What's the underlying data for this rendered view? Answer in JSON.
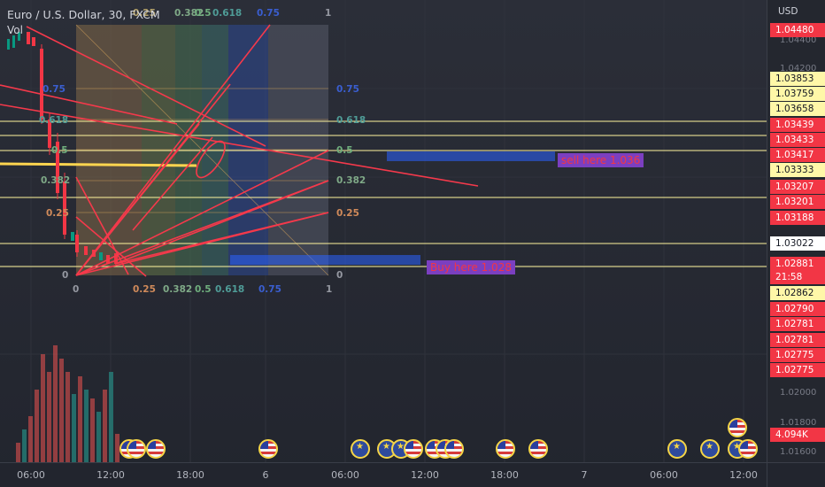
{
  "header": {
    "title": "Euro / U.S. Dollar, 30, FXCM",
    "sub": "Vol"
  },
  "price_scale": {
    "currency": "USD",
    "ticks": [
      "1.04400",
      "1.04200",
      "1.02000",
      "1.01800",
      "1.01600"
    ],
    "labels": [
      {
        "text": "1.04480",
        "style": "red"
      },
      {
        "text": "1.03853",
        "style": "yellow"
      },
      {
        "text": "1.03759",
        "style": "yellow"
      },
      {
        "text": "1.03658",
        "style": "yellow"
      },
      {
        "text": "1.03439",
        "style": "red"
      },
      {
        "text": "1.03433",
        "style": "red"
      },
      {
        "text": "1.03417",
        "style": "red"
      },
      {
        "text": "1.03333",
        "style": "yellow"
      },
      {
        "text": "1.03207",
        "style": "red"
      },
      {
        "text": "1.03201",
        "style": "red"
      },
      {
        "text": "1.03188",
        "style": "red"
      },
      {
        "text": "1.03022",
        "style": "white"
      },
      {
        "text": "1.02881",
        "style": "red"
      },
      {
        "text": "21:58",
        "style": "red"
      },
      {
        "text": "1.02862",
        "style": "yellow"
      },
      {
        "text": "1.02790",
        "style": "red"
      },
      {
        "text": "1.02781",
        "style": "red"
      },
      {
        "text": "1.02781",
        "style": "red"
      },
      {
        "text": "1.02775",
        "style": "red"
      },
      {
        "text": "1.02775",
        "style": "red"
      },
      {
        "text": "4.094K",
        "style": "red"
      }
    ]
  },
  "time_scale": {
    "ticks": [
      "06:00",
      "12:00",
      "18:00",
      "6",
      "06:00",
      "12:00",
      "18:00",
      "7",
      "06:00",
      "12:00"
    ]
  },
  "annotations": {
    "sell_note": "sell here 1.036",
    "buy_note": "Buy here 1.028"
  },
  "fib": {
    "levels": [
      "0",
      "0.25",
      "0.382",
      "0.5",
      "0.618",
      "0.75",
      "1"
    ],
    "left_levels": [
      "0.75",
      "0.618",
      "0.5",
      "0.382",
      "0.25",
      "0"
    ],
    "right_levels": [
      "0.75",
      "0.618",
      "0.5",
      "0.382",
      "0.25",
      "0"
    ],
    "bottom_levels": [
      "0",
      "0.25",
      "0.382",
      "0.5",
      "0.618",
      "0.75",
      "1"
    ],
    "top_levels": [
      "0.25",
      "0.382",
      "0.5",
      "0.618",
      "0.75",
      "1"
    ]
  },
  "events": [
    "us",
    "us",
    "us",
    "us",
    "eu",
    "eu",
    "eu",
    "us",
    "us",
    "us",
    "us",
    "us",
    "us",
    "eu",
    "eu",
    "eu",
    "us",
    "us"
  ],
  "colors": {
    "candle_down": "#f23645",
    "candle_up": "#089981",
    "level_line": "#fff59d",
    "fan_line": "#f5394b",
    "note_bg": "#7b3fc0",
    "note_text": "#f23645"
  }
}
